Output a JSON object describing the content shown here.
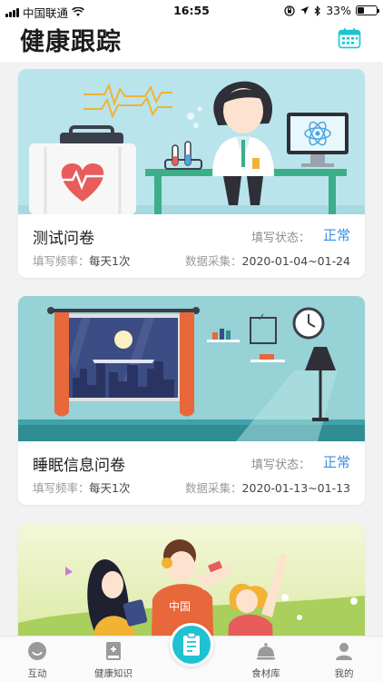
{
  "status_bar": {
    "carrier": "中国联通",
    "time": "16:55",
    "battery": "33%",
    "battery_level": 0.33
  },
  "header": {
    "title": "健康跟踪",
    "calendar_icon": "calendar-icon",
    "accent": "#1fc2d0"
  },
  "cards": [
    {
      "title": "测试问卷",
      "status_label": "填写状态：",
      "status_value": "正常",
      "freq_label": "填写频率：",
      "freq_value": "每天1次",
      "collect_label": "数据采集：",
      "collect_value": "2020-01-04~01-24",
      "illustration": "doctor-lab-illustration"
    },
    {
      "title": "睡眠信息问卷",
      "status_label": "填写状态：",
      "status_value": "正常",
      "freq_label": "填写频率：",
      "freq_value": "每天1次",
      "collect_label": "数据采集：",
      "collect_value": "2020-01-13~01-13",
      "illustration": "bedroom-window-illustration"
    },
    {
      "illustration": "people-music-illustration"
    }
  ],
  "tabbar": {
    "items": [
      {
        "label": "互动",
        "icon": "chat-icon"
      },
      {
        "label": "健康知识",
        "icon": "book-icon"
      },
      {
        "label": "",
        "icon": "clipboard-icon"
      },
      {
        "label": "食材库",
        "icon": "cloche-icon"
      },
      {
        "label": "我的",
        "icon": "user-icon"
      }
    ]
  },
  "colors": {
    "status_ok": "#3a8ee6",
    "accent": "#1fc2d0"
  }
}
